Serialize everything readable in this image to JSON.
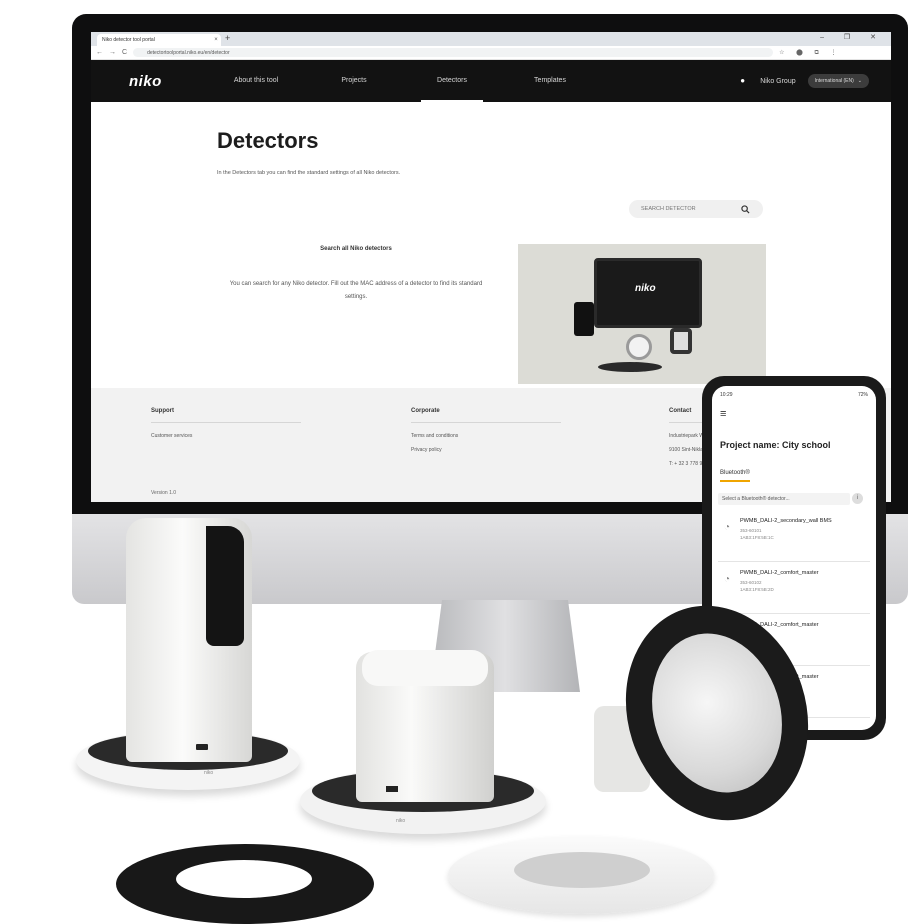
{
  "browser": {
    "tab_title": "Niko detector tool portal",
    "tab_close": "×",
    "new_tab": "+",
    "window_controls": "–  ❐  ✕",
    "url": "detectortoolportal.niko.eu/en/detector",
    "nav_back": "←",
    "nav_forward": "→",
    "reload": "C",
    "extensions": "☆ ⬤ ⧉ ⋮"
  },
  "site": {
    "logo": "niko",
    "nav": [
      {
        "label": "About this tool"
      },
      {
        "label": "Projects"
      },
      {
        "label": "Detectors"
      },
      {
        "label": "Templates"
      }
    ],
    "user": "Niko Group",
    "language": "International (EN)",
    "language_chevron": "⌄"
  },
  "page": {
    "title": "Detectors",
    "intro": "In the Detectors tab you can find the standard settings of all Niko detectors.",
    "search_placeholder": "SEARCH DETECTOR",
    "promo_title": "Search all Niko detectors",
    "promo_text": "You can search for any Niko detector. Fill out the MAC address of a detector to find its standard settings.",
    "promo_image_logo": "niko"
  },
  "footer": {
    "columns": [
      {
        "heading": "Support",
        "links": [
          "Customer services"
        ]
      },
      {
        "heading": "Corporate",
        "links": [
          "Terms and conditions",
          "Privacy policy"
        ]
      },
      {
        "heading": "Contact",
        "links": [
          "Industriepark West 40",
          "9100 Sint-Niklaas",
          "T: + 32 3 778 90 00"
        ]
      }
    ],
    "version": "Version 1.0"
  },
  "phone": {
    "time": "10:29",
    "battery": "72%",
    "menu_glyph": "≡",
    "project_title": "Project name: City school",
    "tab": "Bluetooth®",
    "select": "Select a Bluetooth® detector...",
    "info_glyph": "i",
    "cards": [
      {
        "name": "PWMB_DALI-2_secondary_wall BMS",
        "line1": "353-60101",
        "line2": "1AB3:1F8:5B:1C"
      },
      {
        "name": "PWMB_DALI-2_comfort_master",
        "line1": "353-60102",
        "line2": "1AB3:1F8:5B:2D"
      },
      {
        "name": "PWMB_DALI-2_comfort_master",
        "line1": "353-60103",
        "line2": "1AB3:1F8:5B:3E"
      },
      {
        "name": "PWMB_DALI-2_comfort_master",
        "line1": "",
        "line2": ""
      }
    ]
  },
  "products": {
    "tall_label": "niko",
    "cube_label": "niko"
  },
  "colors": {
    "nav_bg": "#121212",
    "accent": "#f0a500",
    "footer_bg": "#f2f2f2"
  },
  "icons": {
    "search": "search-icon",
    "user": "user-icon",
    "menu": "hamburger-menu-icon",
    "sensor": "sensor-icon"
  }
}
